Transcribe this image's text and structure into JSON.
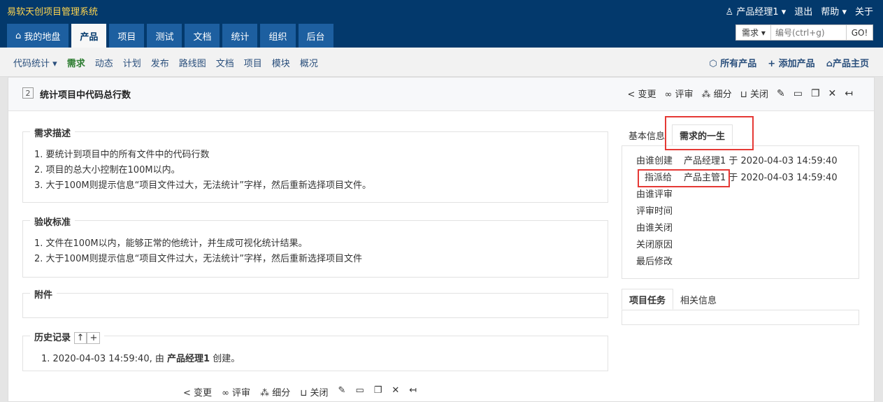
{
  "header": {
    "brand": "易软天创项目管理系统",
    "user": "产品经理1",
    "logout": "退出",
    "help": "帮助",
    "about": "关于"
  },
  "nav": [
    "我的地盘",
    "产品",
    "项目",
    "测试",
    "文档",
    "统计",
    "组织",
    "后台"
  ],
  "search": {
    "type": "需求",
    "placeholder": "编号(ctrl+g)",
    "go": "GO!"
  },
  "subnav": {
    "left": [
      "代码统计",
      "需求",
      "动态",
      "计划",
      "发布",
      "路线图",
      "文档",
      "项目",
      "模块",
      "概况"
    ],
    "right": [
      "所有产品",
      "添加产品",
      "产品主页"
    ]
  },
  "story": {
    "id": "2",
    "title": "统计项目中代码总行数",
    "actions": [
      "变更",
      "评审",
      "细分",
      "关闭"
    ],
    "desc_title": "需求描述",
    "desc": [
      "1. 要统计到项目中的所有文件中的代码行数",
      "2. 项目的总大小控制在100M以内。",
      "3. 大于100M则提示信息“项目文件过大，无法统计”字样，然后重新选择项目文件。"
    ],
    "accept_title": "验收标准",
    "accept": [
      "1. 文件在100M以内，能够正常的他统计，并生成可视化统计结果。",
      "2. 大于100M则提示信息“项目文件过大，无法统计”字样，然后重新选择项目文件"
    ],
    "attach_title": "附件",
    "history_title": "历史记录",
    "history": {
      "prefix": "1. 2020-04-03 14:59:40, 由",
      "who": "产品经理1",
      "suffix": "创建。"
    }
  },
  "side": {
    "tab1": "基本信息",
    "tab2": "需求的一生",
    "life": [
      {
        "k": "由谁创建",
        "v": "产品经理1 于 2020-04-03 14:59:40"
      },
      {
        "k": "指派给",
        "v": "产品主管1 于 2020-04-03 14:59:40"
      },
      {
        "k": "由谁评审",
        "v": ""
      },
      {
        "k": "评审时间",
        "v": ""
      },
      {
        "k": "由谁关闭",
        "v": ""
      },
      {
        "k": "关闭原因",
        "v": ""
      },
      {
        "k": "最后修改",
        "v": ""
      }
    ],
    "tab3": "项目任务",
    "tab4": "相关信息"
  }
}
